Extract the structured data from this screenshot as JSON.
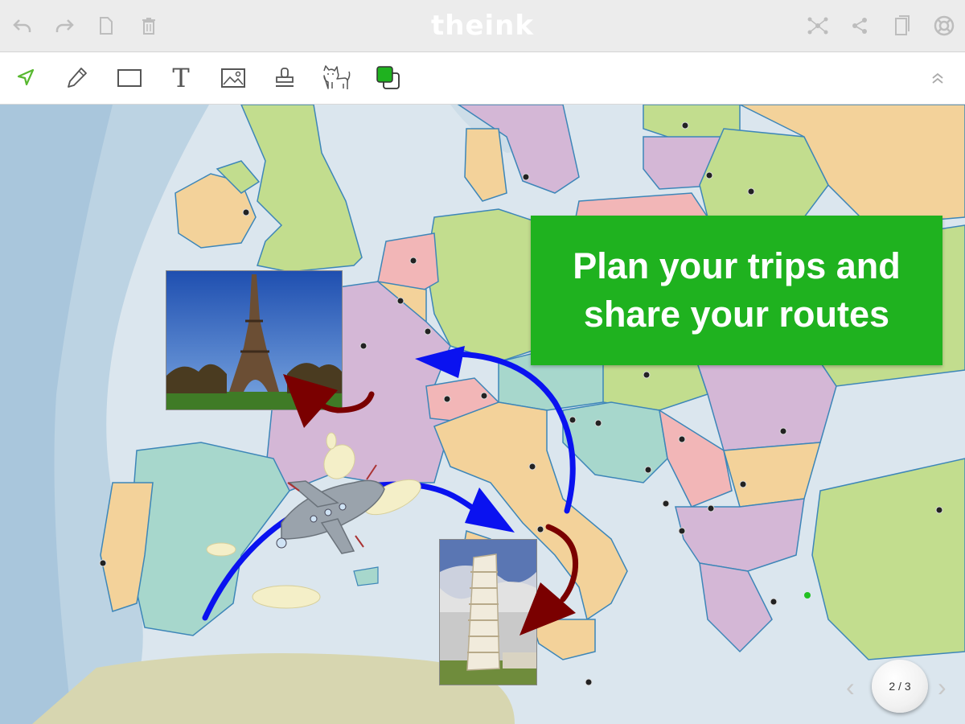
{
  "app": {
    "title": "theink"
  },
  "topbar": {
    "left_icons": [
      "undo-icon",
      "redo-icon",
      "new-page-icon",
      "delete-icon"
    ],
    "right_icons": [
      "network-share-icon",
      "share-icon",
      "pages-icon",
      "help-icon"
    ]
  },
  "toolbar": {
    "tools": [
      "select-tool",
      "pen-tool",
      "rectangle-tool",
      "text-tool",
      "image-tool",
      "stamp-tool",
      "clipart-tool",
      "color-tool"
    ],
    "text_tool_glyph": "T",
    "active_color": "#1fb21f"
  },
  "canvas": {
    "banner_text": "Plan your trips and\nshare  your routes",
    "banner_color": "#1fb21f",
    "images": [
      "eiffel-tower-photo",
      "leaning-tower-of-pisa-photo",
      "airplane-drawing"
    ],
    "arrow_colors": [
      "#0a12f0",
      "#7a0000"
    ]
  },
  "pager": {
    "label": "2 / 3",
    "prev": "‹",
    "next": "›"
  }
}
